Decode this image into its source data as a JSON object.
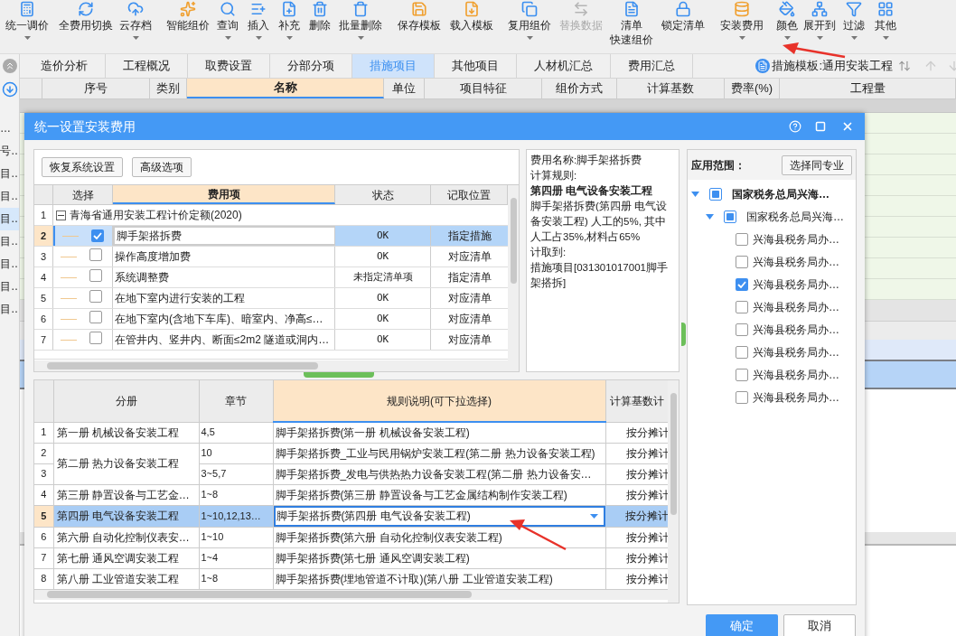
{
  "toolbar": [
    {
      "label": "统一调价",
      "menu": true,
      "disabled": false
    },
    {
      "label": "全费用切换",
      "menu": false,
      "disabled": false
    },
    {
      "label": "云存档",
      "menu": true,
      "disabled": false
    },
    {
      "label": "智能组价",
      "menu": false,
      "disabled": false
    },
    {
      "label": "查询",
      "menu": true,
      "disabled": false
    },
    {
      "label": "插入",
      "menu": true,
      "disabled": false
    },
    {
      "label": "补充",
      "menu": true,
      "disabled": false
    },
    {
      "label": "删除",
      "menu": false,
      "disabled": false
    },
    {
      "label": "批量删除",
      "menu": true,
      "disabled": false
    },
    {
      "label": "保存模板",
      "menu": false,
      "disabled": false
    },
    {
      "label": "载入模板",
      "menu": false,
      "disabled": false
    },
    {
      "label": "复用组价",
      "menu": true,
      "disabled": false
    },
    {
      "label": "替换数据",
      "menu": false,
      "disabled": true
    },
    {
      "label": "清单",
      "label_line2": "快速组价",
      "menu": false,
      "disabled": false
    },
    {
      "label": "锁定清单",
      "menu": false,
      "disabled": false
    },
    {
      "label": "安装费用",
      "menu": true,
      "disabled": false
    },
    {
      "label": "颜色",
      "menu": true,
      "disabled": false
    },
    {
      "label": "展开到",
      "menu": true,
      "disabled": false
    },
    {
      "label": "过滤",
      "menu": true,
      "disabled": false
    },
    {
      "label": "其他",
      "menu": true,
      "disabled": false
    }
  ],
  "tabs": [
    {
      "label": "造价分析",
      "selected": false
    },
    {
      "label": "工程概况",
      "selected": false
    },
    {
      "label": "取费设置",
      "selected": false
    },
    {
      "label": "分部分项",
      "selected": false
    },
    {
      "label": "措施项目",
      "selected": true
    },
    {
      "label": "其他项目",
      "selected": false
    },
    {
      "label": "人材机汇总",
      "selected": false
    },
    {
      "label": "费用汇总",
      "selected": false
    }
  ],
  "template_selector": "措施模板:通用安装工程",
  "sidebar_items": [
    {
      "label": "…",
      "selected": false
    },
    {
      "label": "号…",
      "selected": false
    },
    {
      "label": "目…",
      "selected": false
    },
    {
      "label": "目…",
      "selected": false
    },
    {
      "label": "目…",
      "selected": true
    },
    {
      "label": "目…",
      "selected": false
    },
    {
      "label": "目…",
      "selected": false
    },
    {
      "label": "目…",
      "selected": false
    },
    {
      "label": "目…",
      "selected": false
    }
  ],
  "main_table": {
    "columns": [
      {
        "label": "序号",
        "selected": false
      },
      {
        "label": "类别",
        "selected": false
      },
      {
        "label": "名称",
        "selected": true
      },
      {
        "label": "单位",
        "selected": false
      },
      {
        "label": "项目特征",
        "selected": false
      },
      {
        "label": "组价方式",
        "selected": false
      },
      {
        "label": "计算基数",
        "selected": false
      },
      {
        "label": "费率(%)",
        "selected": false
      },
      {
        "label": "工程量",
        "selected": false
      }
    ]
  },
  "dialog": {
    "title": "统一设置安装费用",
    "buttons": [
      "恢复系统设置",
      "高级选项"
    ],
    "fee_grid": {
      "columns": [
        "选择",
        "费用项",
        "状态",
        "记取位置"
      ],
      "group": {
        "no": "1",
        "label": "青海省通用安装工程计价定额(2020)",
        "expanded": true
      },
      "rows": [
        {
          "no": "2",
          "checked": true,
          "name": "脚手架搭拆费",
          "status": "OK",
          "position": "指定措施",
          "selected": true
        },
        {
          "no": "3",
          "checked": false,
          "name": "操作高度增加费",
          "status": "OK",
          "position": "对应清单",
          "selected": false
        },
        {
          "no": "4",
          "checked": false,
          "name": "系统调整费",
          "status": "未指定清单项",
          "position": "指定清单",
          "selected": false
        },
        {
          "no": "5",
          "checked": false,
          "name": "在地下室内进行安装的工程",
          "status": "OK",
          "position": "对应清单",
          "selected": false
        },
        {
          "no": "6",
          "checked": false,
          "name": "在地下室内(含地下车库)、暗室内、净高≤…",
          "status": "OK",
          "position": "对应清单",
          "selected": false
        },
        {
          "no": "7",
          "checked": false,
          "name": "在管井内、竖井内、断面≤2m2 隧道或洞内…",
          "status": "OK",
          "position": "对应清单",
          "selected": false
        }
      ]
    },
    "info": [
      {
        "text": "费用名称:脚手架搭拆费",
        "bold": false
      },
      {
        "text": "计算规则:",
        "bold": false
      },
      {
        "text": "第四册 电气设备安装工程",
        "bold": true
      },
      {
        "text": "脚手架搭拆费(第四册 电气设备安装工程) 人工的5%, 其中人工占35%,材料占65%",
        "bold": false
      },
      {
        "text": "计取到:",
        "bold": false
      },
      {
        "text": "措施项目[031301017001脚手架搭拆]",
        "bold": false
      }
    ],
    "scope": {
      "label": "应用范围：",
      "button": "选择同专业",
      "tree": {
        "label": "国家税务总局兴海…",
        "expanded": true,
        "checked": false,
        "indeterminate": true,
        "children": [
          {
            "label": "国家税务总局兴海…",
            "expanded": true,
            "checked": false,
            "indeterminate": true,
            "children": [
              {
                "label": "兴海县税务局办…",
                "checked": false
              },
              {
                "label": "兴海县税务局办…",
                "checked": false
              },
              {
                "label": "兴海县税务局办…",
                "checked": true
              },
              {
                "label": "兴海县税务局办…",
                "checked": false
              },
              {
                "label": "兴海县税务局办…",
                "checked": false
              },
              {
                "label": "兴海县税务局办…",
                "checked": false
              },
              {
                "label": "兴海县税务局办…",
                "checked": false
              },
              {
                "label": "兴海县税务局办…",
                "checked": false
              }
            ]
          }
        ]
      }
    },
    "rule_grid": {
      "columns": [
        "分册",
        "章节",
        "规则说明(可下拉选择)",
        "计算基数计"
      ],
      "groups": [
        {
          "volume": "第一册 机械设备安装工程",
          "rows": [
            {
              "no": "1",
              "chapter": "4,5",
              "rule": "脚手架搭拆费(第一册 机械设备安装工程)",
              "base": "按分摊计",
              "selected": false
            }
          ]
        },
        {
          "volume": "第二册 热力设备安装工程",
          "rows": [
            {
              "no": "2",
              "chapter": "10",
              "rule": "脚手架搭拆费_工业与民用锅炉安装工程(第二册 热力设备安装工程)",
              "base": "按分摊计",
              "selected": false
            },
            {
              "no": "3",
              "chapter": "3~5,7",
              "rule": "脚手架搭拆费_发电与供热热力设备安装工程(第二册 热力设备安…",
              "base": "按分摊计",
              "selected": false
            }
          ]
        },
        {
          "volume": "第三册 静置设备与工艺金…",
          "rows": [
            {
              "no": "4",
              "chapter": "1~8",
              "rule": "脚手架搭拆费(第三册 静置设备与工艺金属结构制作安装工程)",
              "base": "按分摊计",
              "selected": false
            }
          ]
        },
        {
          "volume": "第四册 电气设备安装工程",
          "rows": [
            {
              "no": "5",
              "chapter": "1~10,12,13…",
              "rule": "脚手架搭拆费(第四册 电气设备安装工程)",
              "base": "按分摊计",
              "selected": true
            }
          ]
        },
        {
          "volume": "第六册 自动化控制仪表安…",
          "rows": [
            {
              "no": "6",
              "chapter": "1~10",
              "rule": "脚手架搭拆费(第六册 自动化控制仪表安装工程)",
              "base": "按分摊计",
              "selected": false
            }
          ]
        },
        {
          "volume": "第七册 通风空调安装工程",
          "rows": [
            {
              "no": "7",
              "chapter": "1~4",
              "rule": "脚手架搭拆费(第七册 通风空调安装工程)",
              "base": "按分摊计",
              "selected": false
            }
          ]
        },
        {
          "volume": "第八册 工业管道安装工程",
          "rows": [
            {
              "no": "8",
              "chapter": "1~8",
              "rule": "脚手架搭拆费(埋地管道不计取)(第八册 工业管道安装工程)",
              "base": "按分摊计",
              "selected": false
            }
          ]
        }
      ]
    },
    "ok": "确定",
    "cancel": "取消"
  }
}
